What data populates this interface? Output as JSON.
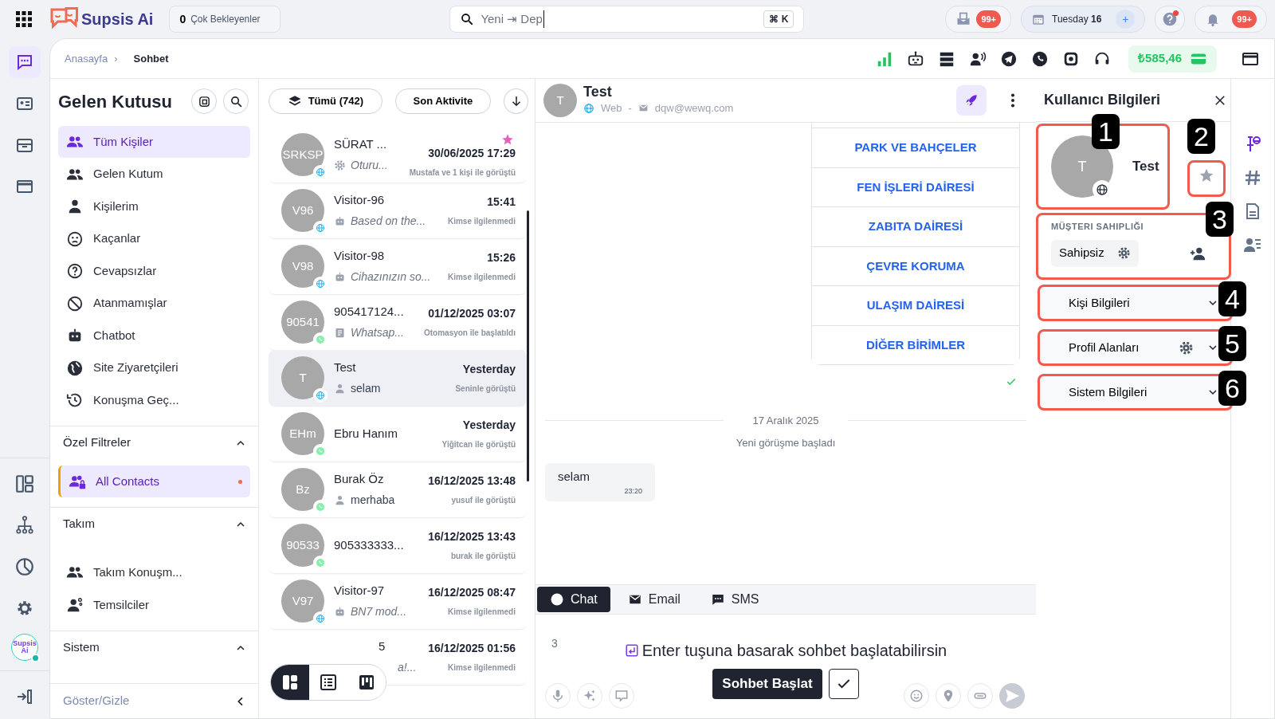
{
  "topbar": {
    "logo": "Supsis Ai",
    "waiting": {
      "count": "0",
      "label": "Çok Bekleyenler"
    },
    "search": {
      "value": "Yeni ⇥ Dep",
      "shortcut_symbol": "⌘",
      "shortcut_key": "K"
    },
    "mail_badge": "99+",
    "date": {
      "day": "Tuesday",
      "number": "16",
      "add": "+"
    },
    "help_alert": true,
    "notification_badge": "99+"
  },
  "rail": {
    "top": [
      {
        "selected": true
      },
      {
        "selected": false
      },
      {
        "selected": false
      },
      {
        "selected": false
      }
    ],
    "avatar_label": "Supsis Ai",
    "online": true
  },
  "breadcrumb": {
    "items": [
      "Anasayfa",
      "Sohbet"
    ],
    "separator": "›"
  },
  "balance": "₺585,46",
  "inbox": {
    "title": "Gelen Kutusu",
    "items": [
      {
        "label": "Tüm Kişiler",
        "selected": true
      },
      {
        "label": "Gelen Kutum",
        "selected": false
      },
      {
        "label": "Kişilerim",
        "selected": false
      },
      {
        "label": "Kaçanlar",
        "selected": false
      },
      {
        "label": "Cevapsızlar",
        "selected": false
      },
      {
        "label": "Atanmamışlar",
        "selected": false
      },
      {
        "label": "Chatbot",
        "selected": false
      },
      {
        "label": "Site Ziyaretçileri",
        "selected": false
      },
      {
        "label": "Konuşma Geç...",
        "selected": false
      }
    ],
    "sections": [
      {
        "title": "Özel Filtreler",
        "expanded": true,
        "items": [
          {
            "label": "All Contacts",
            "selected": true,
            "unread": true
          }
        ]
      },
      {
        "title": "Takım",
        "expanded": true,
        "items": [
          {
            "label": "Takım Konuşm...",
            "selected": false
          },
          {
            "label": "Temsilciler",
            "selected": false
          }
        ]
      },
      {
        "title": "Sistem",
        "expanded": true
      }
    ],
    "toggle": "Göster/Gizle"
  },
  "conversations": {
    "filter": "Tümü (742)",
    "sort": "Son Aktivite",
    "items": [
      {
        "initials": "SRKSP",
        "name": "SÜRAT ...",
        "preview": "Oturu...",
        "time": "30/06/2025 17:29",
        "note": "Mustafa ve 1 kişi ile görüştü",
        "starred": true,
        "selected": false,
        "kind": "web"
      },
      {
        "initials": "V96",
        "name": "Visitor-96",
        "preview": "Based on the...",
        "time": "15:41",
        "note": "Kimse ilgilenmedi",
        "starred": false,
        "selected": false,
        "kind": "web"
      },
      {
        "initials": "V98",
        "name": "Visitor-98",
        "preview": "Cihazınızın so...",
        "time": "15:26",
        "note": "Kimse ilgilenmedi",
        "starred": false,
        "selected": false,
        "kind": "web"
      },
      {
        "initials": "90541",
        "name": "905417124...",
        "preview": "Whatsap...",
        "time": "01/12/2025 03:07",
        "note": "Otomasyon ile başlatıldı",
        "starred": false,
        "selected": false,
        "kind": "whatsapp"
      },
      {
        "initials": "T",
        "name": "Test",
        "preview": "selam",
        "time": "Yesterday",
        "note": "Seninle görüştü",
        "starred": false,
        "selected": true,
        "kind": "web"
      },
      {
        "initials": "EHm",
        "name": "Ebru Hanım",
        "time": "Yesterday",
        "note": "Yiğitcan ile görüştü",
        "starred": false,
        "selected": false,
        "kind": "whatsapp"
      },
      {
        "initials": "Bz",
        "name": "Burak Öz",
        "preview": "merhaba",
        "time": "16/12/2025 13:48",
        "note": "yusuf ile görüştü",
        "starred": false,
        "selected": false,
        "kind": "whatsapp"
      },
      {
        "initials": "90533",
        "name": "905333333...",
        "time": "16/12/2025 13:43",
        "note": "burak ile görüştü",
        "starred": false,
        "selected": false,
        "kind": "whatsapp"
      },
      {
        "initials": "V97",
        "name": "Visitor-97",
        "preview": "BN7 mod...",
        "time": "16/12/2025 08:47",
        "note": "Kimse ilgilenmedi",
        "starred": false,
        "selected": false,
        "kind": "web"
      },
      {
        "name": "5",
        "preview": "a!...",
        "time": "16/12/2025 01:56",
        "note": "Kimse ilgilenmedi",
        "starred": false,
        "selected": false,
        "kind": "obscured"
      }
    ],
    "views": [
      {
        "selected": true
      },
      {
        "selected": false
      },
      {
        "selected": false
      }
    ]
  },
  "chat": {
    "name": "Test",
    "initial": "T",
    "channel": "Web",
    "separator": "-",
    "email": "dqw@wewq.com",
    "menu_options": [
      "PARK VE BAHÇELER",
      "FEN İŞLERİ DAİRESİ",
      "ZABITA DAİRESİ",
      "ÇEVRE KORUMA",
      "ULAŞIM DAİRESİ",
      "DİĞER BİRİMLER"
    ],
    "delivered": true,
    "date": "17 Aralık 2025",
    "event": "Yeni görüşme başladı",
    "messages": [
      {
        "text": "selam",
        "time": "23:20"
      }
    ],
    "tabs": [
      {
        "label": "Chat",
        "selected": true
      },
      {
        "label": "Email",
        "selected": false
      },
      {
        "label": "SMS",
        "selected": false
      }
    ],
    "line_number": "3",
    "hint": "Enter tuşuna basarak sohbet başlatabilirsin",
    "start_button": "Sohbet Başlat"
  },
  "user_panel": {
    "title": "Kullanıcı Bilgileri",
    "initial": "T",
    "name": "Test",
    "starred": false,
    "ownership_label": "MÜŞTERI SAHIPLIĞI",
    "owner": "Sahipsiz",
    "accordions": [
      {
        "label": "Kişi Bilgileri",
        "expanded": false,
        "kind": "plain",
        "callout": "4"
      },
      {
        "label": "Profil Alanları",
        "expanded": false,
        "kind": "settings",
        "callout": "5"
      },
      {
        "label": "Sistem Bilgileri",
        "expanded": false,
        "kind": "plain",
        "callout": "6"
      }
    ],
    "callouts": {
      "profile": "1",
      "star": "2",
      "ownership": "3"
    }
  }
}
